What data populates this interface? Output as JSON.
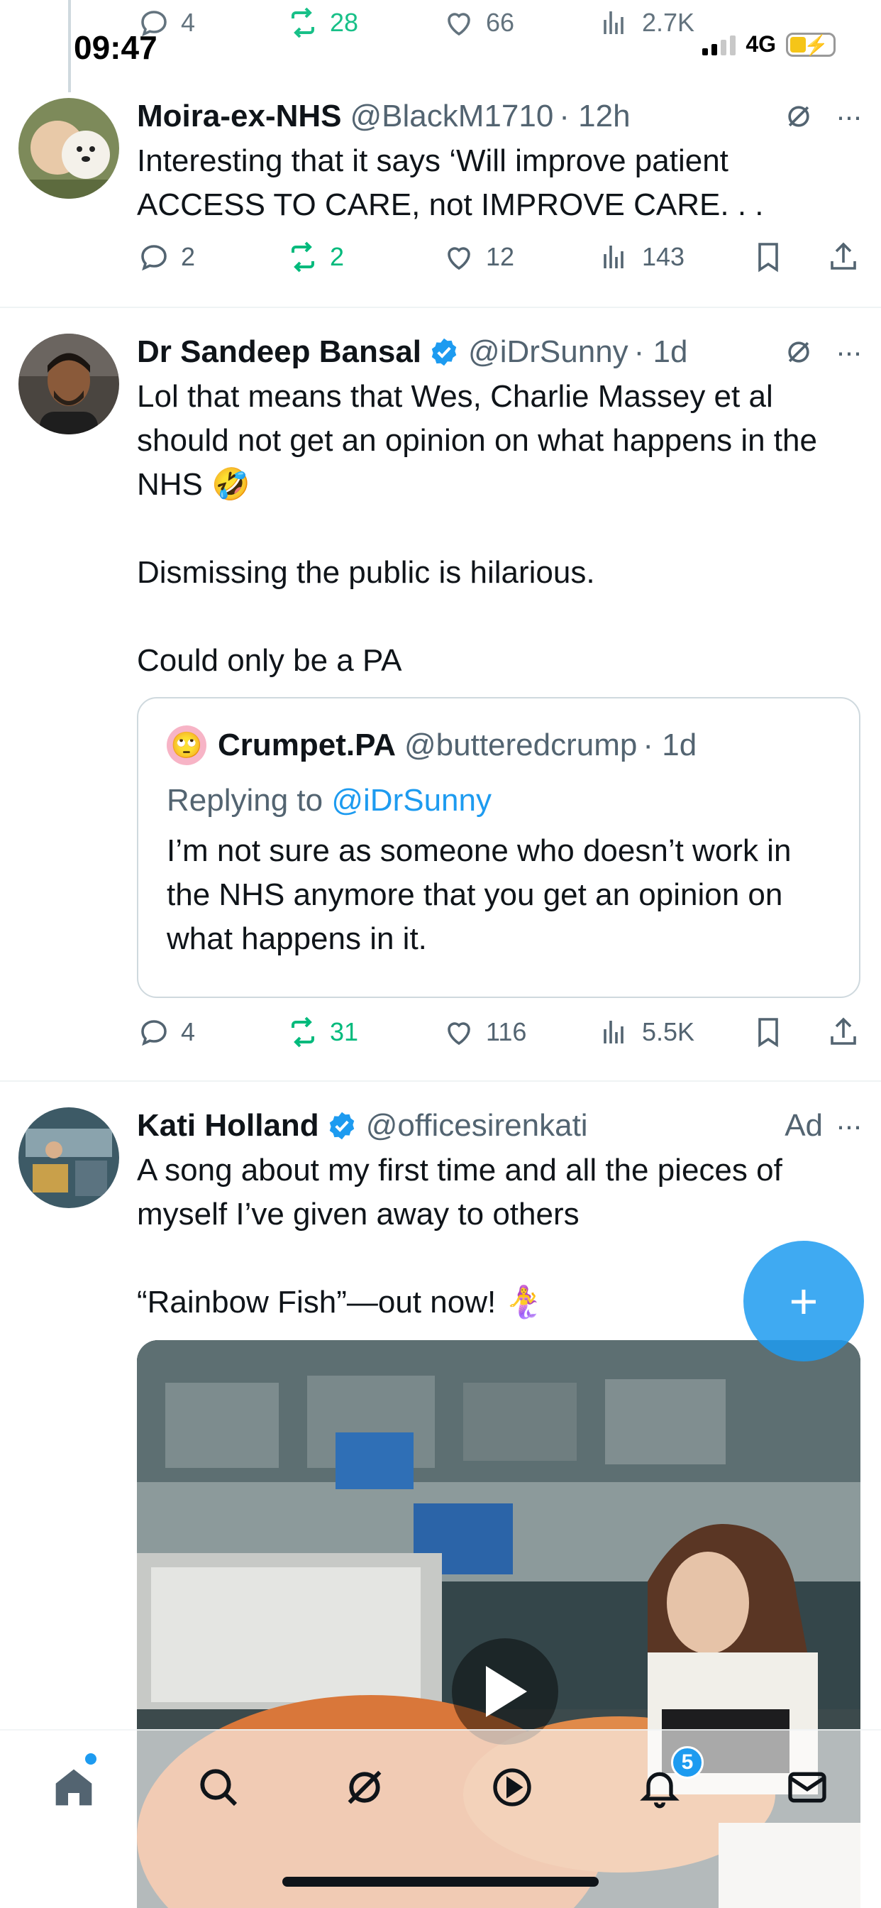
{
  "status": {
    "time": "09:47",
    "network": "4G"
  },
  "top_partial": {
    "replies": "4",
    "retweets": "28",
    "likes": "66",
    "views": "2.7K"
  },
  "tweets": [
    {
      "name": "Moira-ex-NHS",
      "handle": "@BlackM1710",
      "time": "· 12h",
      "text": [
        "Interesting that it says ‘Will improve patient ACCESS TO CARE, not IMPROVE CARE. . ."
      ],
      "replies": "2",
      "retweets": "2",
      "likes": "12",
      "views": "143"
    },
    {
      "name": "Dr Sandeep Bansal",
      "handle": "@iDrSunny",
      "time": "· 1d",
      "text": [
        "Lol that means that Wes, Charlie Massey et al should not get an opinion on what happens in the NHS 🤣",
        "Dismissing the public is hilarious.",
        "Could only be a PA"
      ],
      "quote": {
        "avatar_emoji": "🙄",
        "name": "Crumpet.PA",
        "handle": "@butteredcrump",
        "time": "· 1d",
        "replying_prefix": "Replying to ",
        "replying_handle": "@iDrSunny",
        "text": "I’m not sure as someone who doesn’t work in the NHS anymore that you get an opinion on what happens in it."
      },
      "replies": "4",
      "retweets": "31",
      "likes": "116",
      "views": "5.5K"
    },
    {
      "name": "Kati Holland",
      "handle": "@officesirenkati",
      "ad_label": "Ad",
      "text": [
        "A song about my first time and all the pieces of myself I’ve given away to others",
        "“Rainbow Fish”—out now! 🧜‍♀️"
      ]
    }
  ],
  "nav": {
    "notifications_badge": "5"
  },
  "colors": {
    "accent": "#1d9bf0",
    "retweet": "#00ba7c",
    "muted": "#536471"
  },
  "icons": [
    "reply-icon",
    "retweet-icon",
    "like-icon",
    "views-icon",
    "bookmark-icon",
    "share-icon",
    "grok-icon",
    "more-icon",
    "verified-icon",
    "play-icon",
    "home-icon",
    "search-icon",
    "notifications-icon",
    "messages-icon",
    "compose-icon"
  ]
}
